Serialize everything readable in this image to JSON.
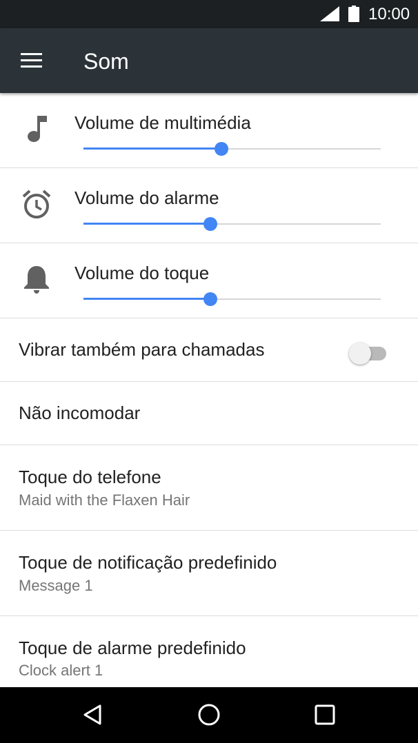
{
  "status_bar": {
    "time": "10:00",
    "icons": [
      "signal-icon",
      "battery-icon"
    ]
  },
  "app_bar": {
    "title": "Som",
    "menu_icon": "hamburger-menu-icon"
  },
  "volume_sliders": [
    {
      "label": "Volume de multimédia",
      "icon": "music-note-icon",
      "level": 0.465
    },
    {
      "label": "Volume do alarme",
      "icon": "alarm-clock-icon",
      "level": 0.428
    },
    {
      "label": "Volume do toque",
      "icon": "bell-icon",
      "level": 0.428
    }
  ],
  "settings": {
    "vibrate": {
      "label": "Vibrar também para chamadas",
      "enabled": false
    },
    "do_not_disturb": {
      "label": "Não incomodar"
    },
    "phone_ringtone": {
      "label": "Toque do telefone",
      "value": "Maid with the Flaxen Hair"
    },
    "notification_sound": {
      "label": "Toque de notificação predefinido",
      "value": "Message 1"
    },
    "alarm_sound": {
      "label": "Toque de alarme predefinido",
      "value": "Clock alert 1"
    }
  },
  "nav_bar": {
    "buttons": [
      "back-icon",
      "home-icon",
      "recents-icon"
    ]
  },
  "colors": {
    "accent": "#4285f4",
    "app_bar": "#2b3338",
    "status_bar": "#1c2023",
    "nav_bar": "#000000"
  }
}
